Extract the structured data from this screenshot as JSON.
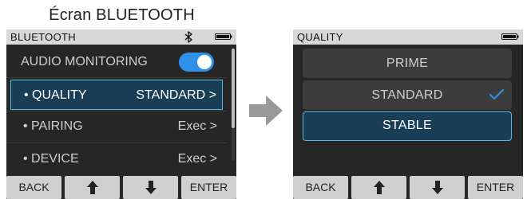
{
  "caption": "Écran BLUETOOTH",
  "left_screen": {
    "title": "BLUETOOTH",
    "rows": [
      {
        "label": "AUDIO MONITORING",
        "toggle_on": true
      },
      {
        "label": "• QUALITY",
        "value": "STANDARD >",
        "selected": true
      },
      {
        "label": "• PAIRING",
        "value": "Exec >"
      },
      {
        "label": "• DEVICE",
        "value": "Exec >"
      }
    ],
    "buttons": {
      "back": "BACK",
      "up": "arrow-up-icon",
      "down": "arrow-down-icon",
      "enter": "ENTER"
    }
  },
  "right_screen": {
    "title": "QUALITY",
    "options": [
      {
        "label": "PRIME"
      },
      {
        "label": "STANDARD",
        "checked": true
      },
      {
        "label": "STABLE",
        "selected": true
      }
    ],
    "buttons": {
      "back": "BACK",
      "up": "arrow-up-icon",
      "down": "arrow-down-icon",
      "enter": "ENTER"
    }
  },
  "colors": {
    "accent": "#2f90e8",
    "selection_border": "#5ab8e6",
    "selection_fill": "#1a3e56",
    "screen_bg": "#262626"
  },
  "icons": [
    "bluetooth-icon",
    "battery-icon",
    "check-icon",
    "arrow-right-icon",
    "arrow-up-icon",
    "arrow-down-icon"
  ]
}
